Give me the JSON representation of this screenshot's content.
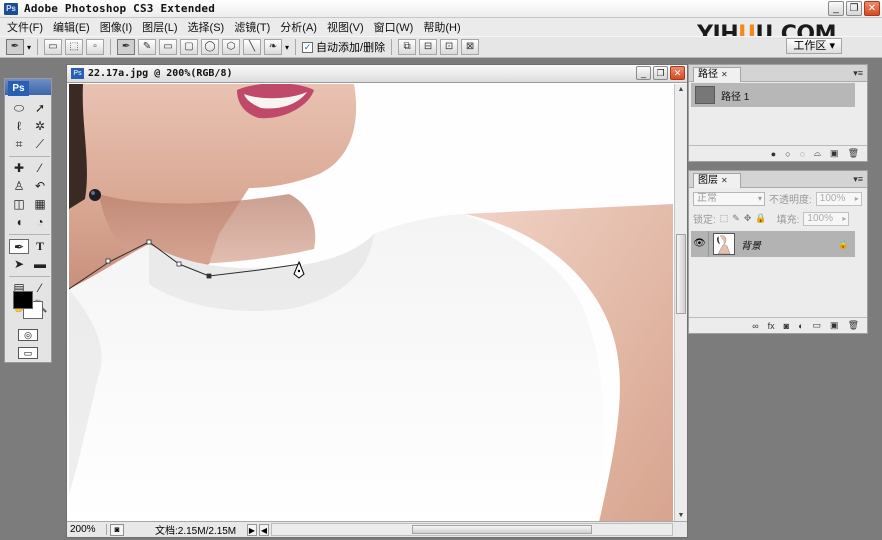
{
  "window": {
    "title": "Adobe Photoshop CS3 Extended",
    "buttons": [
      "_",
      "❐",
      "✕"
    ]
  },
  "menu": [
    "文件(F)",
    "编辑(E)",
    "图像(I)",
    "图层(L)",
    "选择(S)",
    "滤镜(T)",
    "分析(A)",
    "视图(V)",
    "窗口(W)",
    "帮助(H)"
  ],
  "watermark": {
    "yi": "YIH",
    "u": "U",
    "rest": "U.COM"
  },
  "options": {
    "auto_add_delete_label": "自动添加/删除",
    "auto_add_delete_checked": true,
    "workspace_label": "工作区 ▾"
  },
  "toolbox": {
    "logo": "Ps"
  },
  "document": {
    "title": "22.17a.jpg @ 200%(RGB/8)",
    "zoom": "200%",
    "doc_info": "文档:2.15M/2.15M"
  },
  "paths_panel": {
    "tab": "路径",
    "items": [
      {
        "name": "路径 1"
      }
    ]
  },
  "layers_panel": {
    "tab": "图层",
    "blend_mode": "正常",
    "opacity_label": "不透明度:",
    "opacity": "100%",
    "lock_label": "锁定:",
    "fill_label": "填充:",
    "fill": "100%",
    "layers": [
      {
        "name": "背景",
        "visible": true,
        "locked": true
      }
    ]
  },
  "colors": {
    "foreground": "#000000",
    "background": "#ffffff",
    "accent": "#2760b2",
    "brand_orange": "#f08a1a"
  }
}
